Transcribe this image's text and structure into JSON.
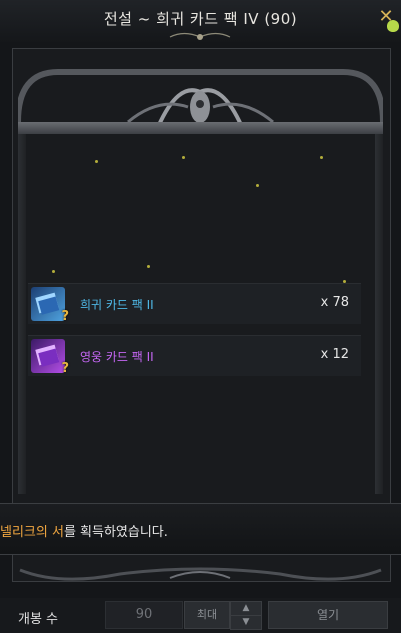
{
  "window": {
    "title": "전설 ~ 희귀 카드 팩 IV (90)",
    "close_icon": "close-x-icon"
  },
  "items": [
    {
      "name": "희귀 카드 팩 II",
      "count": "x 78",
      "icon": "rare-card-pack-icon",
      "color": "#4fb8e6"
    },
    {
      "name": "영웅 카드 팩 II",
      "count": "x 12",
      "icon": "hero-card-pack-icon",
      "color": "#c466f2"
    }
  ],
  "notice": {
    "highlight": "넬리크의 서",
    "rest": "를 획득하였습니다.",
    "highlight_color": "#f0a640"
  },
  "open_bar": {
    "label": "개봉 수",
    "quantity": "90",
    "max_label": "최대",
    "open_label": "열기"
  }
}
